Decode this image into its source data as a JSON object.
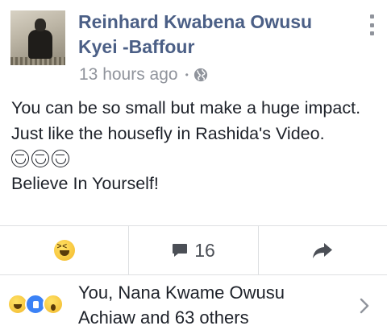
{
  "post": {
    "author": "Reinhard Kwabena Owusu Kyei -Baffour",
    "time": "13 hours ago",
    "separator": "•",
    "text_line1": "You can be so small but make a huge impact. Just like the housefly in Rashida's Video.",
    "emojis": [
      "laughing-face",
      "laughing-face",
      "laughing-face"
    ],
    "text_line2": "Believe In Yourself!"
  },
  "actions": {
    "reaction_icon": "haha-reaction-icon",
    "comment_icon": "comment-icon",
    "comment_count": "16",
    "share_icon": "share-icon"
  },
  "reactions": {
    "icons": [
      "haha",
      "like",
      "wow"
    ],
    "summary": "You, Nana Kwame Owusu Achiaw and 63 others"
  },
  "colors": {
    "author": "#4b5f86",
    "meta": "#90949c",
    "text": "#1d2129",
    "divider": "#dddfe2"
  }
}
